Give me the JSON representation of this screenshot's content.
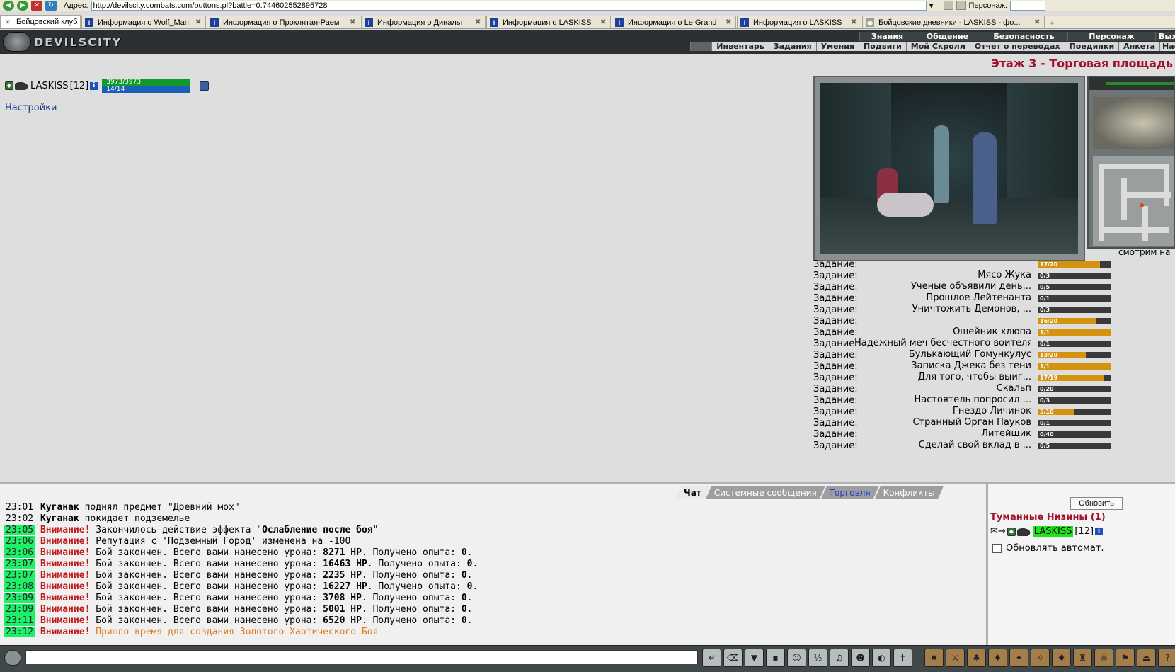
{
  "browser": {
    "address_label": "Адрес:",
    "url": "http://devilscity.combats.com/buttons.pl?battle=0.744602552895728",
    "person_label": "Персонаж:",
    "tabs": [
      {
        "label": "Бойцовский клуб",
        "active": true
      },
      {
        "label": "Информация о Wolf_Man"
      },
      {
        "label": "Информация о Проклятая-Раем"
      },
      {
        "label": "Информация о Динальт"
      },
      {
        "label": "Информация о LASKISS"
      },
      {
        "label": "Информация о Le Grand"
      },
      {
        "label": "Информация о LASKISS"
      },
      {
        "label": "Бойцовские дневники - LASKISS - фо..."
      }
    ]
  },
  "header": {
    "logo_text": "DEVILSCITY",
    "menu_top": [
      "Знания",
      "Общение",
      "Безопасность",
      "Персонаж",
      "Выход"
    ],
    "menu_bottom": [
      "Инвентарь",
      "Задания",
      "Умения",
      "Подвиги",
      "Мой Скролл",
      "Отчет о переводах",
      "Поединки",
      "Анкета",
      "Настройки"
    ]
  },
  "character": {
    "name": "LASKISS",
    "level": "[12]",
    "hp_text": "3973/3973",
    "mp_text": "14/14",
    "settings_link": "Настройки"
  },
  "location": {
    "title": "Этаж 3 - Торговая площадь",
    "exit": "Вы"
  },
  "looking_text": "смотрим на",
  "quests": {
    "label": "Задание:",
    "items": [
      {
        "name": "",
        "value": "17/20",
        "progress": 0.85
      },
      {
        "name": "Мясо Жука",
        "value": "0/3",
        "progress": 0
      },
      {
        "name": "Ученые объявили день...",
        "value": "0/5",
        "progress": 0
      },
      {
        "name": "Прошлое Лейтенанта",
        "value": "0/1",
        "progress": 0
      },
      {
        "name": "Уничтожить Демонов, ...",
        "value": "0/3",
        "progress": 0
      },
      {
        "name": "",
        "value": "16/20",
        "progress": 0.8
      },
      {
        "name": "Ошейник хлюпа",
        "value": "1/1",
        "progress": 1
      },
      {
        "name": "Надежный меч бесчестного воителя",
        "value": "0/1",
        "progress": 0
      },
      {
        "name": "Булькающий Гомункулус",
        "value": "13/20",
        "progress": 0.65
      },
      {
        "name": "Записка Джека без тени",
        "value": "1/1",
        "progress": 1
      },
      {
        "name": "Для того, чтобы выиг...",
        "value": "17/19",
        "progress": 0.89
      },
      {
        "name": "Скальп",
        "value": "0/20",
        "progress": 0
      },
      {
        "name": "Настоятель попросил ...",
        "value": "0/3",
        "progress": 0
      },
      {
        "name": "Гнездо Личинок",
        "value": "5/10",
        "progress": 0.5
      },
      {
        "name": "Странный Орган Пауков",
        "value": "0/1",
        "progress": 0
      },
      {
        "name": "Литейщик",
        "value": "0/40",
        "progress": 0
      },
      {
        "name": "Сделай свой вклад в ...",
        "value": "0/5",
        "progress": 0
      }
    ]
  },
  "chat": {
    "tabs": [
      "Чат",
      "Системные сообщения",
      "Торговля",
      "Конфликты"
    ],
    "warn": "Внимание!",
    "messages": [
      {
        "time": "23:01",
        "hl": false,
        "parts": [
          {
            "k": "b",
            "t": "Куганак"
          },
          {
            "k": "",
            "t": " поднял предмет \"Древний мох\""
          }
        ]
      },
      {
        "time": "23:02",
        "hl": false,
        "parts": [
          {
            "k": "b",
            "t": "Куганак"
          },
          {
            "k": "",
            "t": " покидает подземелье"
          }
        ]
      },
      {
        "time": "23:05",
        "hl": true,
        "parts": [
          {
            "k": "w",
            "t": "Внимание!"
          },
          {
            "k": "",
            "t": " Закончилось действие эффекта \""
          },
          {
            "k": "b",
            "t": "Ослабление после боя"
          },
          {
            "k": "",
            "t": "\""
          }
        ]
      },
      {
        "time": "23:06",
        "hl": true,
        "parts": [
          {
            "k": "w",
            "t": "Внимание!"
          },
          {
            "k": "",
            "t": " Репутация с 'Подземный Город' изменена на -100"
          }
        ]
      },
      {
        "time": "23:06",
        "hl": true,
        "parts": [
          {
            "k": "w",
            "t": "Внимание!"
          },
          {
            "k": "",
            "t": " Бой закончен. Всего вами нанесено урона: "
          },
          {
            "k": "b",
            "t": "8271 HP"
          },
          {
            "k": "",
            "t": ". Получено опыта: "
          },
          {
            "k": "b",
            "t": "0"
          },
          {
            "k": "",
            "t": "."
          }
        ]
      },
      {
        "time": "23:07",
        "hl": true,
        "parts": [
          {
            "k": "w",
            "t": "Внимание!"
          },
          {
            "k": "",
            "t": " Бой закончен. Всего вами нанесено урона: "
          },
          {
            "k": "b",
            "t": "16463 HP"
          },
          {
            "k": "",
            "t": ". Получено опыта: "
          },
          {
            "k": "b",
            "t": "0"
          },
          {
            "k": "",
            "t": "."
          }
        ]
      },
      {
        "time": "23:07",
        "hl": true,
        "parts": [
          {
            "k": "w",
            "t": "Внимание!"
          },
          {
            "k": "",
            "t": " Бой закончен. Всего вами нанесено урона: "
          },
          {
            "k": "b",
            "t": "2235 HP"
          },
          {
            "k": "",
            "t": ". Получено опыта: "
          },
          {
            "k": "b",
            "t": "0"
          },
          {
            "k": "",
            "t": "."
          }
        ]
      },
      {
        "time": "23:08",
        "hl": true,
        "parts": [
          {
            "k": "w",
            "t": "Внимание!"
          },
          {
            "k": "",
            "t": " Бой закончен. Всего вами нанесено урона: "
          },
          {
            "k": "b",
            "t": "16227 HP"
          },
          {
            "k": "",
            "t": ". Получено опыта: "
          },
          {
            "k": "b",
            "t": "0"
          },
          {
            "k": "",
            "t": "."
          }
        ]
      },
      {
        "time": "23:09",
        "hl": true,
        "parts": [
          {
            "k": "w",
            "t": "Внимание!"
          },
          {
            "k": "",
            "t": " Бой закончен. Всего вами нанесено урона: "
          },
          {
            "k": "b",
            "t": "3708 HP"
          },
          {
            "k": "",
            "t": ". Получено опыта: "
          },
          {
            "k": "b",
            "t": "0"
          },
          {
            "k": "",
            "t": "."
          }
        ]
      },
      {
        "time": "23:09",
        "hl": true,
        "parts": [
          {
            "k": "w",
            "t": "Внимание!"
          },
          {
            "k": "",
            "t": " Бой закончен. Всего вами нанесено урона: "
          },
          {
            "k": "b",
            "t": "5001 HP"
          },
          {
            "k": "",
            "t": ". Получено опыта: "
          },
          {
            "k": "b",
            "t": "0"
          },
          {
            "k": "",
            "t": "."
          }
        ]
      },
      {
        "time": "23:11",
        "hl": true,
        "parts": [
          {
            "k": "w",
            "t": "Внимание!"
          },
          {
            "k": "",
            "t": " Бой закончен. Всего вами нанесено урона: "
          },
          {
            "k": "b",
            "t": "6520 HP"
          },
          {
            "k": "",
            "t": ". Получено опыта: "
          },
          {
            "k": "b",
            "t": "0"
          },
          {
            "k": "",
            "t": "."
          }
        ]
      },
      {
        "time": "23:12",
        "hl": true,
        "parts": [
          {
            "k": "w",
            "t": "Внимание!"
          },
          {
            "k": "o",
            "t": " Пришло время для создания Золотого Хаотического Боя"
          }
        ]
      }
    ]
  },
  "side": {
    "refresh_button": "Обновить",
    "room_title": "Туманные Низины (1)",
    "user_name": "LASKISS",
    "user_level": "[12]",
    "auto_refresh_label": "Обновлять автомат."
  },
  "colors": {
    "warning": "#c01818",
    "time_highlight": "#1ef06a",
    "location": "#a0102a",
    "quest_fill": "#d4920e"
  }
}
